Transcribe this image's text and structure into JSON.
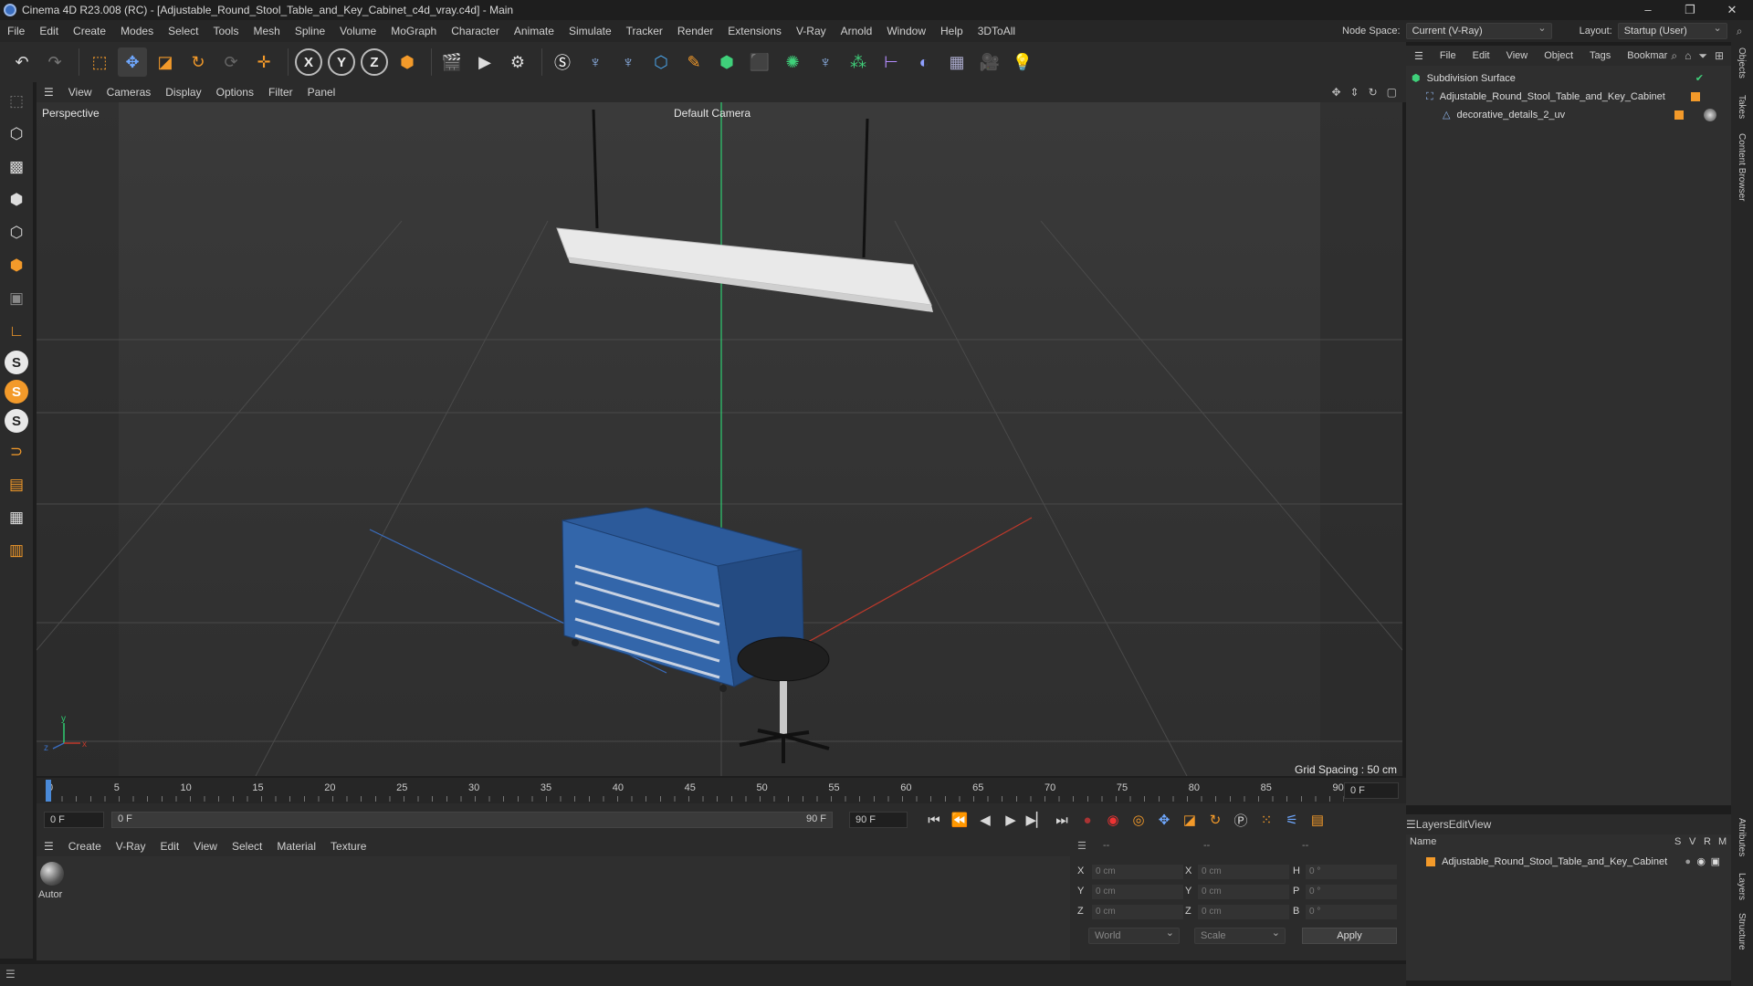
{
  "window": {
    "title": "Cinema 4D R23.008 (RC) - [Adjustable_Round_Stool_Table_and_Key_Cabinet_c4d_vray.c4d] - Main",
    "minimize": "–",
    "restore": "❐",
    "close": "✕"
  },
  "menu": [
    "File",
    "Edit",
    "Create",
    "Modes",
    "Select",
    "Tools",
    "Mesh",
    "Spline",
    "Volume",
    "MoGraph",
    "Character",
    "Animate",
    "Simulate",
    "Tracker",
    "Render",
    "Extensions",
    "V-Ray",
    "Arnold",
    "Window",
    "Help",
    "3DToAll"
  ],
  "node_space": {
    "label": "Node Space:",
    "value": "Current (V-Ray)"
  },
  "layout": {
    "label": "Layout:",
    "value": "Startup (User)"
  },
  "viewport": {
    "menu": [
      "View",
      "Cameras",
      "Display",
      "Options",
      "Filter",
      "Panel"
    ],
    "label": "Perspective",
    "camera": "Default Camera",
    "grid_spacing": "Grid Spacing : 50 cm"
  },
  "timeline": {
    "ticks": [
      "0",
      "5",
      "10",
      "15",
      "20",
      "25",
      "30",
      "35",
      "40",
      "45",
      "50",
      "55",
      "60",
      "65",
      "70",
      "75",
      "80",
      "85",
      "90"
    ],
    "current_frame": "0 F",
    "end_field": "0 F"
  },
  "playback": {
    "start": "0 F",
    "range_start": "0 F",
    "range_end": "90 F",
    "end": "90 F"
  },
  "material_panel": {
    "menu": [
      "Create",
      "V-Ray",
      "Edit",
      "View",
      "Select",
      "Material",
      "Texture"
    ],
    "material_name": "Autor"
  },
  "coordinates": {
    "header_left": "--",
    "header_mid": "--",
    "header_right": "--",
    "rows": [
      {
        "axis": "X",
        "pos": "0 cm",
        "axis2": "X",
        "size": "0 cm",
        "axis3": "H",
        "rot": "0 °"
      },
      {
        "axis": "Y",
        "pos": "0 cm",
        "axis2": "Y",
        "size": "0 cm",
        "axis3": "P",
        "rot": "0 °"
      },
      {
        "axis": "Z",
        "pos": "0 cm",
        "axis2": "Z",
        "size": "0 cm",
        "axis3": "B",
        "rot": "0 °"
      }
    ],
    "mode": "World",
    "transform": "Scale",
    "apply": "Apply"
  },
  "objects_panel": {
    "menu": [
      "File",
      "Edit",
      "View",
      "Object",
      "Tags",
      "Bookmar"
    ],
    "items": [
      {
        "name": "Subdivision Surface",
        "level": 0
      },
      {
        "name": "Adjustable_Round_Stool_Table_and_Key_Cabinet",
        "level": 1
      },
      {
        "name": "decorative_details_2_uv",
        "level": 2
      }
    ]
  },
  "layers_panel": {
    "menu": [
      "Layers",
      "Edit",
      "View"
    ],
    "columns": {
      "name": "Name",
      "s": "S",
      "v": "V",
      "r": "R",
      "m": "M"
    },
    "items": [
      {
        "name": "Adjustable_Round_Stool_Table_and_Key_Cabinet"
      }
    ]
  },
  "right_tabs": [
    "Objects",
    "Takes",
    "Content Browser",
    "Attributes",
    "Layers",
    "Structure"
  ],
  "colors": {
    "accent": "#f39a2a",
    "cabinet": "#2c5a9a",
    "axis_x": "#c0392b",
    "axis_y": "#2ecc71",
    "axis_z": "#3a6ec0"
  }
}
